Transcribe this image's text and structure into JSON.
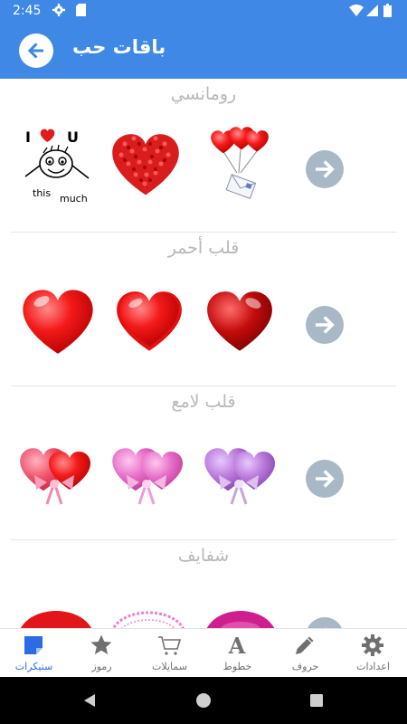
{
  "status_bar": {
    "time": "2:45"
  },
  "app_bar": {
    "title": "باقات حب"
  },
  "sections": [
    {
      "title": "رومانسي"
    },
    {
      "title": "قلب أحمر"
    },
    {
      "title": "قلب لامع"
    },
    {
      "title": "شفايف"
    }
  ],
  "bottom_nav": [
    {
      "label": "ستيكرات",
      "icon": "sticker-icon",
      "active": true
    },
    {
      "label": "رموز",
      "icon": "star-icon",
      "active": false
    },
    {
      "label": "سمايلات",
      "icon": "cart-icon",
      "active": false
    },
    {
      "label": "خطوط",
      "icon": "font-icon",
      "active": false
    },
    {
      "label": "حروف",
      "icon": "pencil-icon",
      "active": false
    },
    {
      "label": "اعدادات",
      "icon": "gear-icon",
      "active": false
    }
  ],
  "colors": {
    "primary": "#3f88e6",
    "accent_active": "#2c6be3",
    "section_title": "#b8b8b8",
    "next_arrow": "#a9b8c6"
  }
}
